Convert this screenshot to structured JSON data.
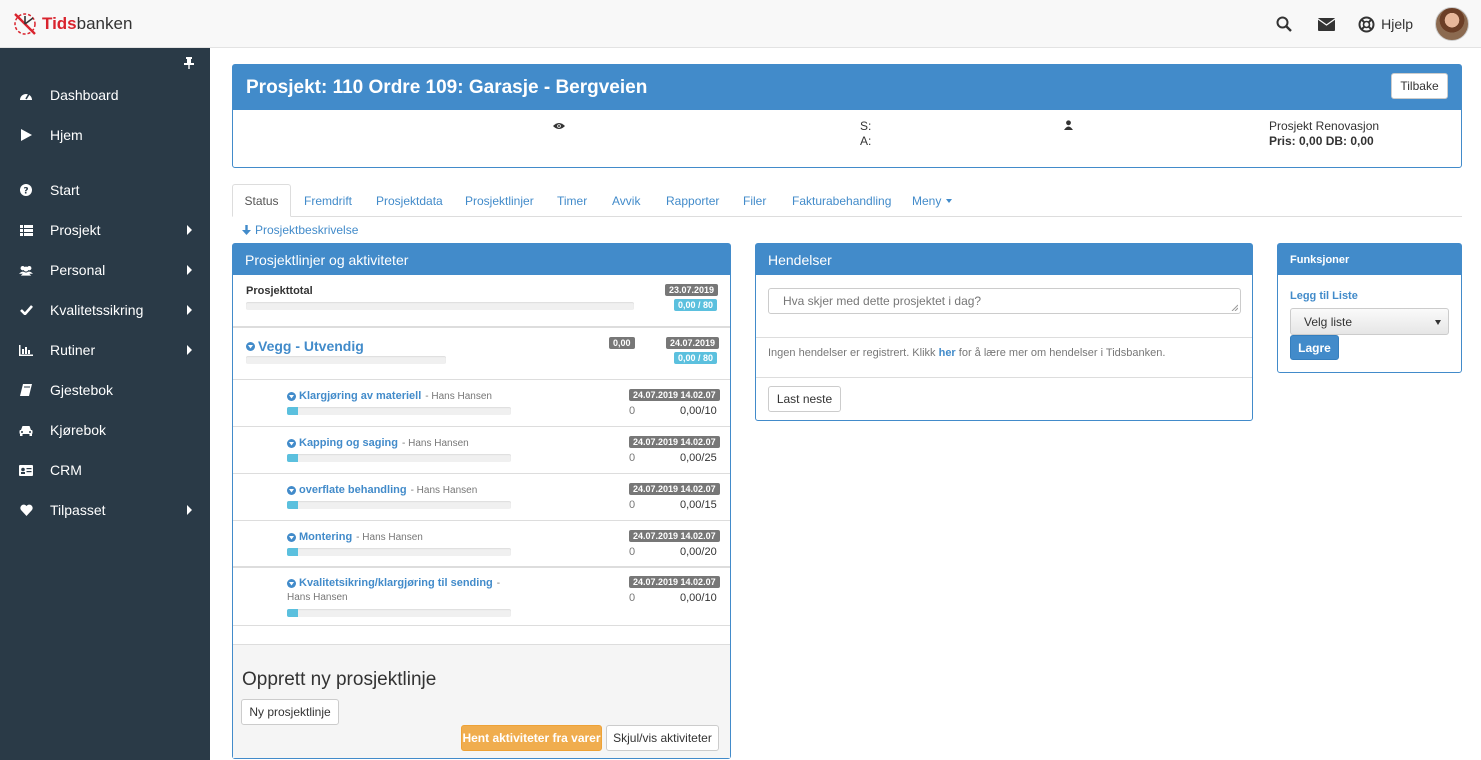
{
  "app": {
    "logo_prefix": "Tids",
    "logo_suffix": "banken",
    "help_label": "Hjelp",
    "brand_color": "#d9232d",
    "accent_color": "#428bca"
  },
  "sidebar": {
    "items": [
      {
        "label": "Dashboard",
        "icon": "dashboard-icon",
        "submenu": false
      },
      {
        "label": "Hjem",
        "icon": "play-icon",
        "submenu": false
      },
      {
        "label": "Start",
        "icon": "question-icon",
        "submenu": false
      },
      {
        "label": "Prosjekt",
        "icon": "list-icon",
        "submenu": true
      },
      {
        "label": "Personal",
        "icon": "users-icon",
        "submenu": true
      },
      {
        "label": "Kvalitetssikring",
        "icon": "check-icon",
        "submenu": true
      },
      {
        "label": "Rutiner",
        "icon": "bar-chart-icon",
        "submenu": true
      },
      {
        "label": "Gjestebok",
        "icon": "book-icon",
        "submenu": false
      },
      {
        "label": "Kjørebok",
        "icon": "car-icon",
        "submenu": false
      },
      {
        "label": "CRM",
        "icon": "id-card-icon",
        "submenu": false
      },
      {
        "label": "Tilpasset",
        "icon": "heart-icon",
        "submenu": true
      }
    ]
  },
  "project": {
    "title": "Prosjekt: 110 Ordre 109: Garasje - Bergveien",
    "back_label": "Tilbake",
    "s_label": "S:",
    "a_label": "A:",
    "category": "Prosjekt Renovasjon",
    "price_line": "Pris: 0,00 DB: 0,00"
  },
  "tabs": [
    {
      "label": "Status",
      "active": true
    },
    {
      "label": "Fremdrift",
      "active": false
    },
    {
      "label": "Prosjektdata",
      "active": false
    },
    {
      "label": "Prosjektlinjer",
      "active": false
    },
    {
      "label": "Timer",
      "active": false
    },
    {
      "label": "Avvik",
      "active": false
    },
    {
      "label": "Rapporter",
      "active": false
    },
    {
      "label": "Filer",
      "active": false
    },
    {
      "label": "Fakturabehandling",
      "active": false
    },
    {
      "label": "Meny",
      "active": false,
      "dropdown": true
    }
  ],
  "description_link": "Prosjektbeskrivelse",
  "project_lines": {
    "title": "Prosjektlinjer og aktiviteter",
    "total": {
      "label": "Prosjekttotal",
      "date": "23.07.2019",
      "ratio": "0,00 / 80"
    },
    "group": {
      "label": "Vegg - Utvendig",
      "amount": "0,00",
      "date": "24.07.2019",
      "ratio": "0,00 / 80"
    },
    "activities": [
      {
        "title": "Klargjøring av materiell",
        "person": "- Hans Hansen",
        "timestamp": "24.07.2019 14.02.07",
        "count": "0",
        "ratio": "0,00/10",
        "progress": 0.03
      },
      {
        "title": "Kapping og saging",
        "person": "- Hans Hansen",
        "timestamp": "24.07.2019 14.02.07",
        "count": "0",
        "ratio": "0,00/25",
        "progress": 0.03
      },
      {
        "title": "overflate behandling",
        "person": "- Hans Hansen",
        "timestamp": "24.07.2019 14.02.07",
        "count": "0",
        "ratio": "0,00/15",
        "progress": 0.03
      },
      {
        "title": "Montering",
        "person": "- Hans Hansen",
        "timestamp": "24.07.2019 14.02.07",
        "count": "0",
        "ratio": "0,00/20",
        "progress": 0.03
      },
      {
        "title": "Kvalitetsikring/klargjøring til sending",
        "person_prefix": "-",
        "person": "Hans Hansen",
        "timestamp": "24.07.2019 14.02.07",
        "count": "0",
        "ratio": "0,00/10",
        "progress": 0.03
      }
    ],
    "create_title": "Opprett ny prosjektlinje",
    "new_line_button": "Ny prosjektlinje",
    "fetch_button": "Hent aktiviteter fra varer",
    "toggle_button": "Skjul/vis aktiviteter"
  },
  "events": {
    "title": "Hendelser",
    "placeholder": "Hva skjer med dette prosjektet i dag?",
    "empty_prefix": "Ingen hendelser er registrert. Klikk ",
    "empty_link": "her",
    "empty_suffix": " for å lære mer om hendelser i Tidsbanken.",
    "load_next": "Last neste"
  },
  "functions": {
    "title": "Funksjoner",
    "add_to_list": "Legg til Liste",
    "select_value": "Velg liste",
    "save": "Lagre"
  }
}
